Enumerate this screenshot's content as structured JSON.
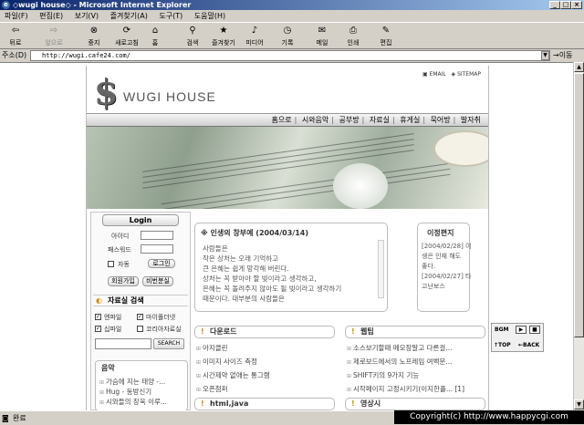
{
  "window": {
    "title": "◇wugi house◇ - Microsoft Internet Explorer"
  },
  "menu": [
    "파일(F)",
    "편집(E)",
    "보기(V)",
    "즐겨찾기(A)",
    "도구(T)",
    "도움말(H)"
  ],
  "toolbar": {
    "back": "뒤로",
    "forward": "앞으로",
    "stop": "중지",
    "refresh": "새로고침",
    "home": "홈",
    "search": "검색",
    "favorites": "즐겨찾기",
    "media": "미디어",
    "history": "기록",
    "mail": "메일",
    "print": "인쇄",
    "edit": "편집"
  },
  "address": {
    "label": "주소(D)",
    "url": "http://wugi.cafe24.com/",
    "go": "이동"
  },
  "site": {
    "logo_symbol": "$",
    "logo_text": "WUGI HOUSE",
    "email_link": "EMAIL",
    "sitemap_link": "SITEMAP",
    "nav": [
      "홈으로",
      "시와음악",
      "공부방",
      "자료실",
      "휴게실",
      "묵어방",
      "발자취"
    ]
  },
  "login": {
    "title": "Login",
    "id_label": "아이디",
    "pw_label": "패스워드",
    "auto_label": "자동",
    "login_button": "로그인",
    "join_button": "회원가입",
    "find_button": "비번분실"
  },
  "search": {
    "title": "자료실 검색",
    "options": [
      "엔파일",
      "마이폴더넷",
      "십파일",
      "코리아자료실"
    ],
    "button": "SEARCH"
  },
  "music": {
    "title": "음악",
    "items": [
      "가슴에 지는 태양 -...",
      "Hug - 동방신기",
      "시와들의 장욱 이루..."
    ]
  },
  "board": {
    "title": "※ 인생의 창부예 (2004/03/14)",
    "lines": [
      "사람들은",
      "작은 상처는 오래 기억하고",
      "큰 은혜는 쉽게 망각해 버린다.",
      "상처는 꼭 받아야 할 빚이라고 생각하고,",
      "은혜는 꼭 돌려주지 않아도 될 빚이라고 생각하기",
      "때문이다. 대부분의 사람들은"
    ]
  },
  "letter": {
    "title": "이정편지",
    "lines": [
      "[2004/02/28] 이",
      "생은 인재 해도",
      "좋다.",
      "[2004/02/27] 타",
      "고난보스"
    ]
  },
  "sections": {
    "download": {
      "title": "다운로드",
      "items": [
        "아지클린",
        "이미지 사이즈 측정",
        "시간제약 없애는 통그램",
        "오픈첨퍼"
      ]
    },
    "webtip": {
      "title": "웹팁",
      "items": [
        "소스보기할때 메모장말고 다른걸...",
        "제로보드에서의 노프레임 여백문...",
        "SHIFT키의 9가지 기능",
        "시작페이지 고정시키기(이지한플... [1]"
      ]
    },
    "html": {
      "title": "html,java"
    },
    "video": {
      "title": "영상시"
    }
  },
  "music_player": {
    "bgm_label": "BGM",
    "top": "TOP",
    "back": "BACK"
  },
  "status": {
    "text": "완료",
    "copyright": "Copyright(c) http://www.happycgi.com"
  }
}
